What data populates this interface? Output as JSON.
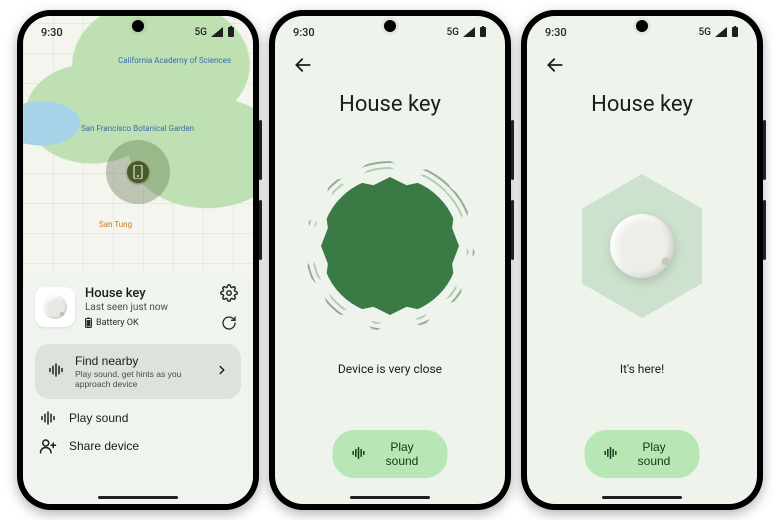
{
  "status": {
    "time": "9:30",
    "net": "5G"
  },
  "icons": {
    "sound": "sound-bars-icon",
    "share": "person-plus-icon",
    "gear": "gear-icon",
    "refresh": "refresh-icon",
    "back": "arrow-back-icon",
    "chev": "chevron-right-icon",
    "battery": "battery-icon",
    "signal": "signal-icon",
    "marker": "phone-marker-icon"
  },
  "phone1": {
    "map_pois": {
      "academy": "California Academy of Sciences",
      "garden": "San Francisco Botanical Garden",
      "santung": "San Tung"
    },
    "device": {
      "name": "House key",
      "last_seen": "Last seen just now",
      "battery": "Battery OK"
    },
    "find": {
      "title": "Find nearby",
      "subtitle": "Play sound, get hints as you approach device"
    },
    "actions": {
      "play_sound": "Play sound",
      "share": "Share device"
    }
  },
  "phone2": {
    "title": "House key",
    "status": "Device is very close",
    "button": "Play sound"
  },
  "phone3": {
    "title": "House key",
    "status": "It's here!",
    "button": "Play sound"
  }
}
